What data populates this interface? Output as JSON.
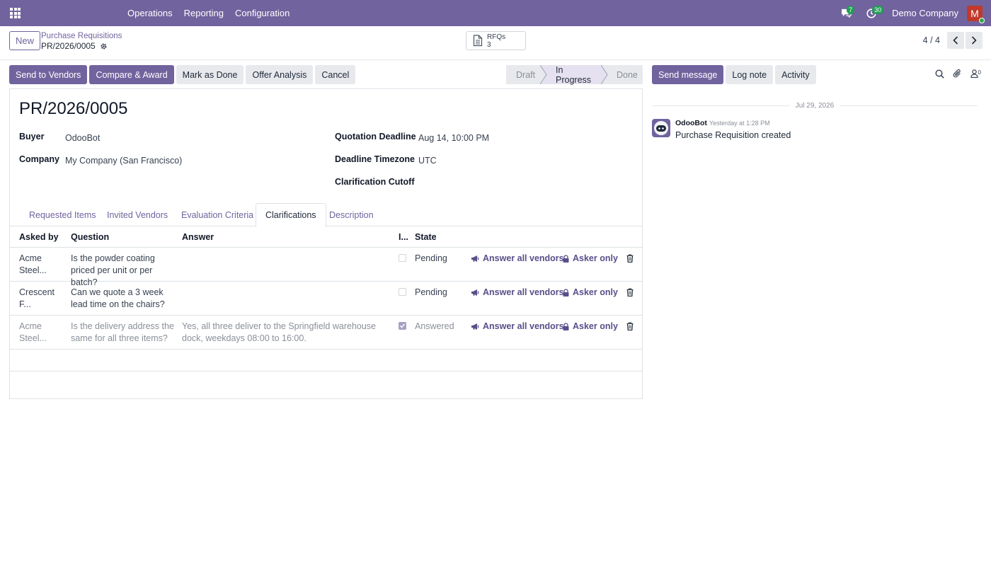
{
  "navbar": {
    "menu": [
      "Operations",
      "Reporting",
      "Configuration"
    ],
    "messages_count": "7",
    "activities_count": "30",
    "company": "Demo Company",
    "avatar_letter": "M"
  },
  "control": {
    "new_label": "New",
    "breadcrumb_parent": "Purchase Requisitions",
    "breadcrumb_current": "PR/2026/0005",
    "smart_button": {
      "label": "RFQs",
      "count": "3"
    },
    "pager": "4 / 4"
  },
  "actions": {
    "send_to_vendors": "Send to Vendors",
    "compare_award": "Compare & Award",
    "mark_done": "Mark as Done",
    "offer_analysis": "Offer Analysis",
    "cancel": "Cancel"
  },
  "statusbar": {
    "stages": [
      "Draft",
      "In Progress",
      "Done"
    ],
    "active": "In Progress"
  },
  "form": {
    "title": "PR/2026/0005",
    "buyer_label": "Buyer",
    "buyer": "OdooBot",
    "company_label": "Company",
    "company": "My Company (San Francisco)",
    "deadline_label": "Quotation Deadline",
    "deadline": "Aug 14, 10:00 PM",
    "tz_label": "Deadline Timezone",
    "tz": "UTC",
    "cutoff_label": "Clarification Cutoff",
    "cutoff": ""
  },
  "tabs": [
    "Requested Items",
    "Invited Vendors",
    "Evaluation Criteria",
    "Clarifications",
    "Description"
  ],
  "active_tab": "Clarifications",
  "table": {
    "headers": {
      "asked_by": "Asked by",
      "question": "Question",
      "answer": "Answer",
      "flag": "I...",
      "state": "State"
    },
    "rows": [
      {
        "asked_by": "Acme Steel...",
        "question": "Is the powder coating priced per unit or per batch?",
        "answer": "",
        "checked": false,
        "state": "Pending",
        "answer_all": "Answer all vendors",
        "asker_only": "Asker only"
      },
      {
        "asked_by": "Crescent F...",
        "question": "Can we quote a 3 week lead time on the chairs?",
        "answer": "",
        "checked": false,
        "state": "Pending",
        "answer_all": "Answer all vendors",
        "asker_only": "Asker only"
      },
      {
        "asked_by": "Acme Steel...",
        "question": "Is the delivery address the same for all three items?",
        "answer": "Yes, all three deliver to the Springfield warehouse dock, weekdays 08:00 to 16:00.",
        "checked": true,
        "state": "Answered",
        "answer_all": "Answer all vendors",
        "asker_only": "Asker only"
      }
    ]
  },
  "chatter": {
    "send_message": "Send message",
    "log_note": "Log note",
    "activity": "Activity",
    "followers": "0",
    "date": "Jul 29, 2026",
    "author": "OdooBot",
    "time": "Yesterday at 1:28 PM",
    "message": "Purchase Requisition created"
  }
}
